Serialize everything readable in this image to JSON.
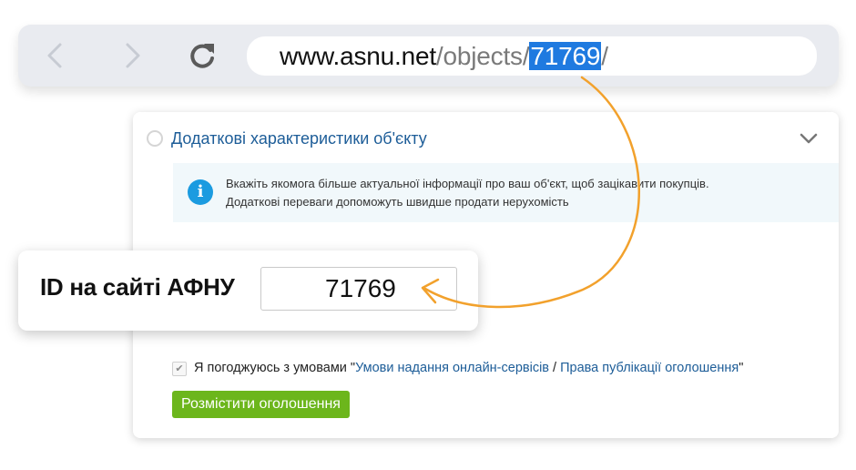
{
  "browser": {
    "url_host": "www.asnu.net",
    "url_path": "/objects/",
    "url_id": "71769",
    "url_trailing": "/"
  },
  "form": {
    "section_title": "Додаткові характеристики об'єкту",
    "info_line_1": "Вкажіть якомога більше актуальної інформації про ваш об'єкт, щоб зацікавити покупців.",
    "info_line_2": "Додаткові переваги допоможуть  швидше продати нерухомість",
    "info_icon_glyph": "i",
    "agree_prefix": "Я погоджуюсь з умовами \"",
    "agree_link_1": "Умови надання онлайн-сервісів",
    "agree_sep": " / ",
    "agree_link_2": "Права публікації оголошення",
    "agree_suffix": "\"",
    "agree_checked": true,
    "submit_label": "Розмістити оголошення"
  },
  "callout": {
    "label": "ID на сайті АФНУ",
    "value": "71769"
  },
  "colors": {
    "accent_arrow": "#f2a12c",
    "url_highlight": "#1f7ae0",
    "link": "#1d5d98",
    "submit": "#6cb61c",
    "info_bg": "#f1f8fb"
  },
  "icons": {
    "back": "chevron-left-icon",
    "forward": "chevron-right-icon",
    "reload": "reload-icon",
    "section_radio": "radio-icon",
    "collapse": "chevron-down-icon",
    "info": "info-icon",
    "check": "check-icon",
    "arrow": "curved-arrow-icon"
  }
}
